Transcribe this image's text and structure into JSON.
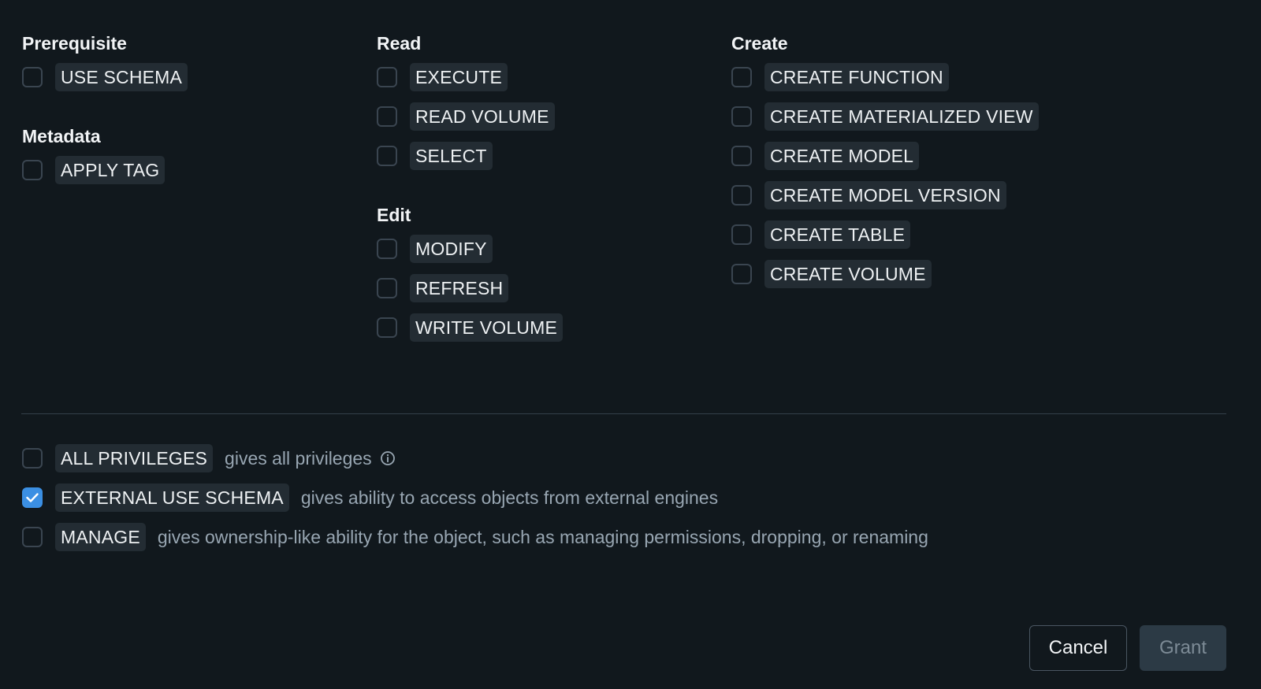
{
  "groups": {
    "prerequisite": {
      "title": "Prerequisite",
      "items": [
        {
          "label": "USE SCHEMA",
          "checked": false
        }
      ]
    },
    "metadata": {
      "title": "Metadata",
      "items": [
        {
          "label": "APPLY TAG",
          "checked": false
        }
      ]
    },
    "read": {
      "title": "Read",
      "items": [
        {
          "label": "EXECUTE",
          "checked": false
        },
        {
          "label": "READ VOLUME",
          "checked": false
        },
        {
          "label": "SELECT",
          "checked": false
        }
      ]
    },
    "edit": {
      "title": "Edit",
      "items": [
        {
          "label": "MODIFY",
          "checked": false
        },
        {
          "label": "REFRESH",
          "checked": false
        },
        {
          "label": "WRITE VOLUME",
          "checked": false
        }
      ]
    },
    "create": {
      "title": "Create",
      "items": [
        {
          "label": "CREATE FUNCTION",
          "checked": false
        },
        {
          "label": "CREATE MATERIALIZED VIEW",
          "checked": false
        },
        {
          "label": "CREATE MODEL",
          "checked": false
        },
        {
          "label": "CREATE MODEL VERSION",
          "checked": false
        },
        {
          "label": "CREATE TABLE",
          "checked": false
        },
        {
          "label": "CREATE VOLUME",
          "checked": false
        }
      ]
    }
  },
  "special": [
    {
      "label": "ALL PRIVILEGES",
      "description": "gives all privileges",
      "checked": false,
      "icon": "info-icon"
    },
    {
      "label": "EXTERNAL USE SCHEMA",
      "description": "gives ability to access objects from external engines",
      "checked": true
    },
    {
      "label": "MANAGE",
      "description": "gives ownership-like ability for the object, such as managing permissions, dropping, or renaming",
      "checked": false
    }
  ],
  "actions": {
    "cancel_label": "Cancel",
    "grant_label": "Grant"
  },
  "colors": {
    "background": "#11181d",
    "chip": "#232c33",
    "checkbox_checked": "#3b8fe3",
    "description": "#98a6b2",
    "grant_disabled_bg": "#2c3a45"
  }
}
